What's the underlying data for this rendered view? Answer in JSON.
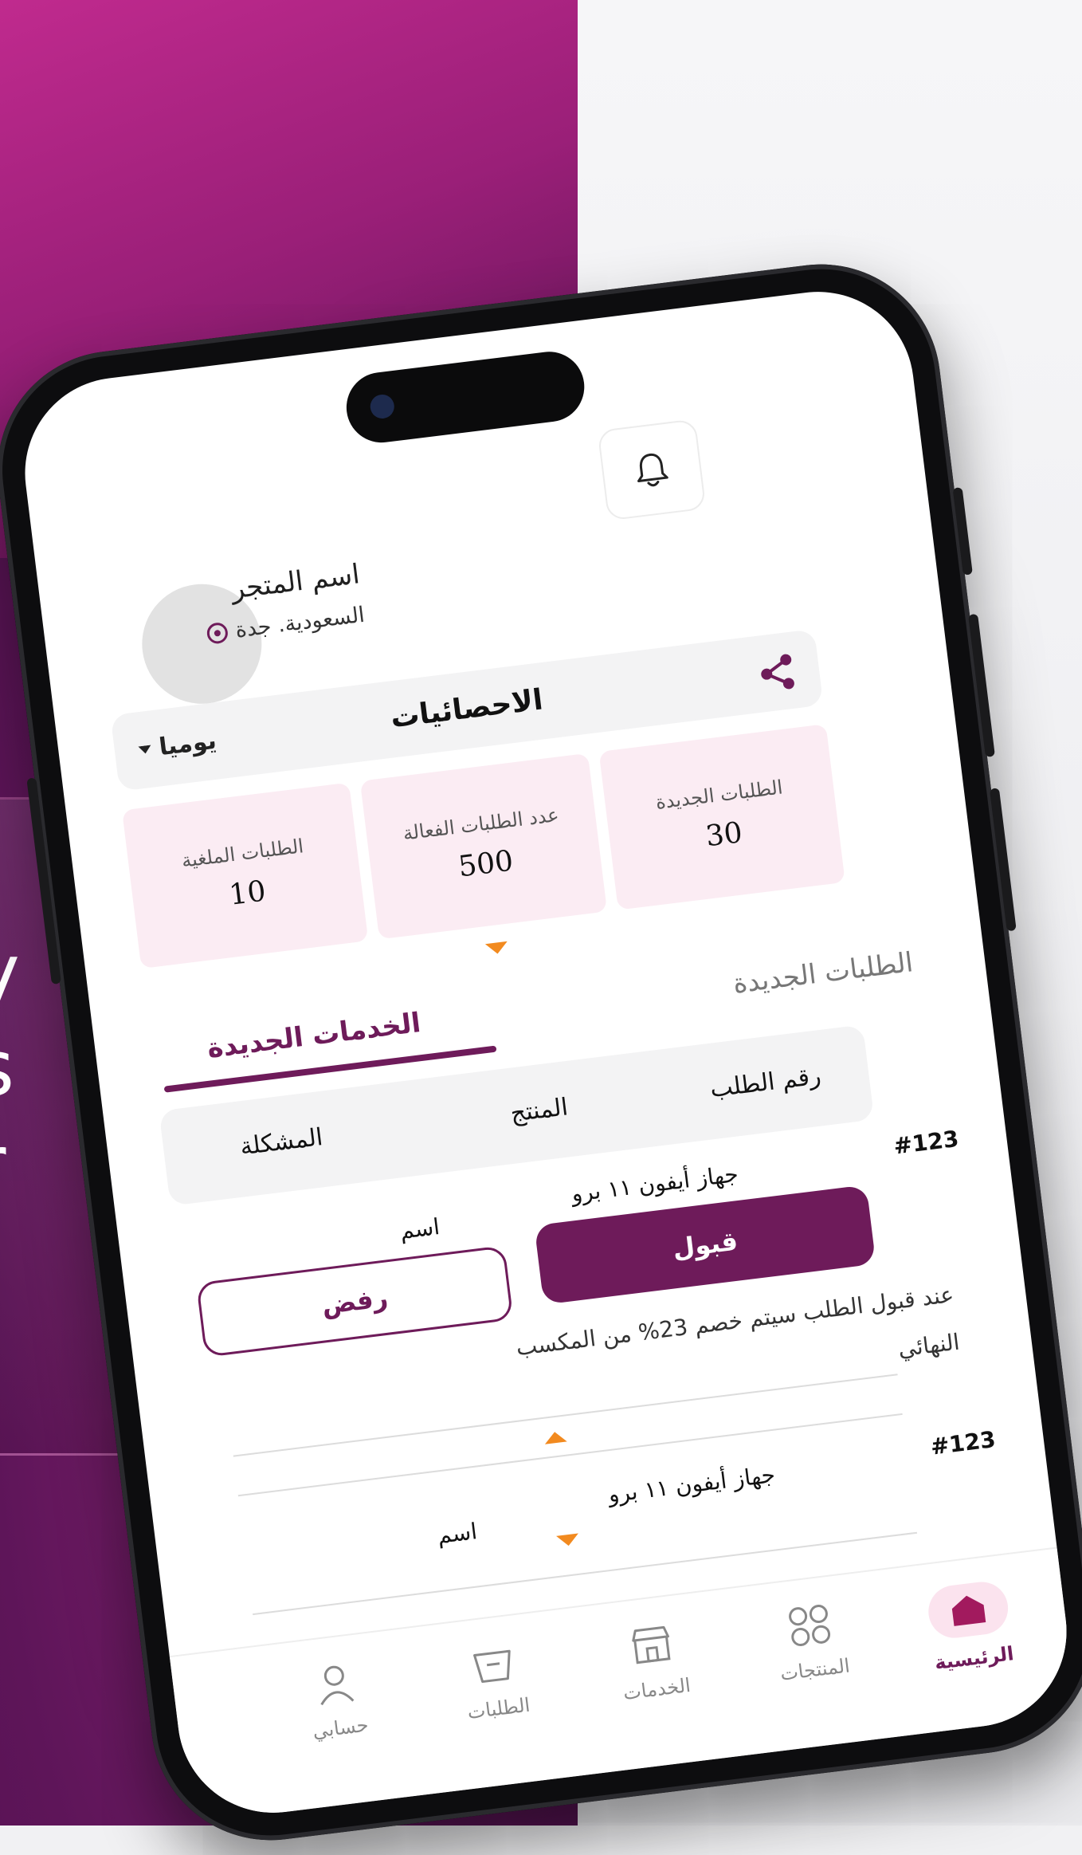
{
  "colors": {
    "brand": "#6e1b5a",
    "accent_orange": "#f28a1f",
    "card_bg": "#fbecf3"
  },
  "background_text": [
    "y",
    "s",
    "r"
  ],
  "header": {
    "store_name": "اسم المتجر",
    "store_location": "السعودية. جدة",
    "notifications_icon": "bell-icon",
    "location_icon": "pin-icon"
  },
  "stats": {
    "title": "الاحصائيات",
    "period": "يوميا",
    "share_icon": "share-icon",
    "cards": [
      {
        "label": "الطلبات الجديدة",
        "value": "30"
      },
      {
        "label": "عدد الطلبات الفعالة",
        "value": "500"
      },
      {
        "label": "الطلبات الملغية",
        "value": "10"
      }
    ]
  },
  "tabs": [
    {
      "label": "الطلبات الجديدة",
      "active": false
    },
    {
      "label": "الخدمات الجديدة",
      "active": true
    }
  ],
  "table": {
    "headers": [
      "رقم الطلب",
      "المنتج",
      "المشكلة"
    ],
    "rows": [
      {
        "order_no": "#123",
        "product": "جهاز أيفون ١١ برو",
        "problem": "اسم",
        "expanded": true
      },
      {
        "order_no": "#123",
        "product": "جهاز أيفون ١١ برو",
        "problem": "اسم",
        "expanded": false
      }
    ]
  },
  "actions": {
    "accept": "قبول",
    "reject": "رفض",
    "note_line1": "عند قبول الطلب سيتم خصم 23% من المكسب",
    "note_line2": "النهائي"
  },
  "bottom_nav": [
    {
      "label": "الرئيسية",
      "icon": "home-icon",
      "active": true
    },
    {
      "label": "المنتجات",
      "icon": "grid-icon",
      "active": false
    },
    {
      "label": "الخدمات",
      "icon": "store-icon",
      "active": false
    },
    {
      "label": "الطلبات",
      "icon": "basket-icon",
      "active": false
    },
    {
      "label": "حسابي",
      "icon": "user-icon",
      "active": false
    }
  ]
}
